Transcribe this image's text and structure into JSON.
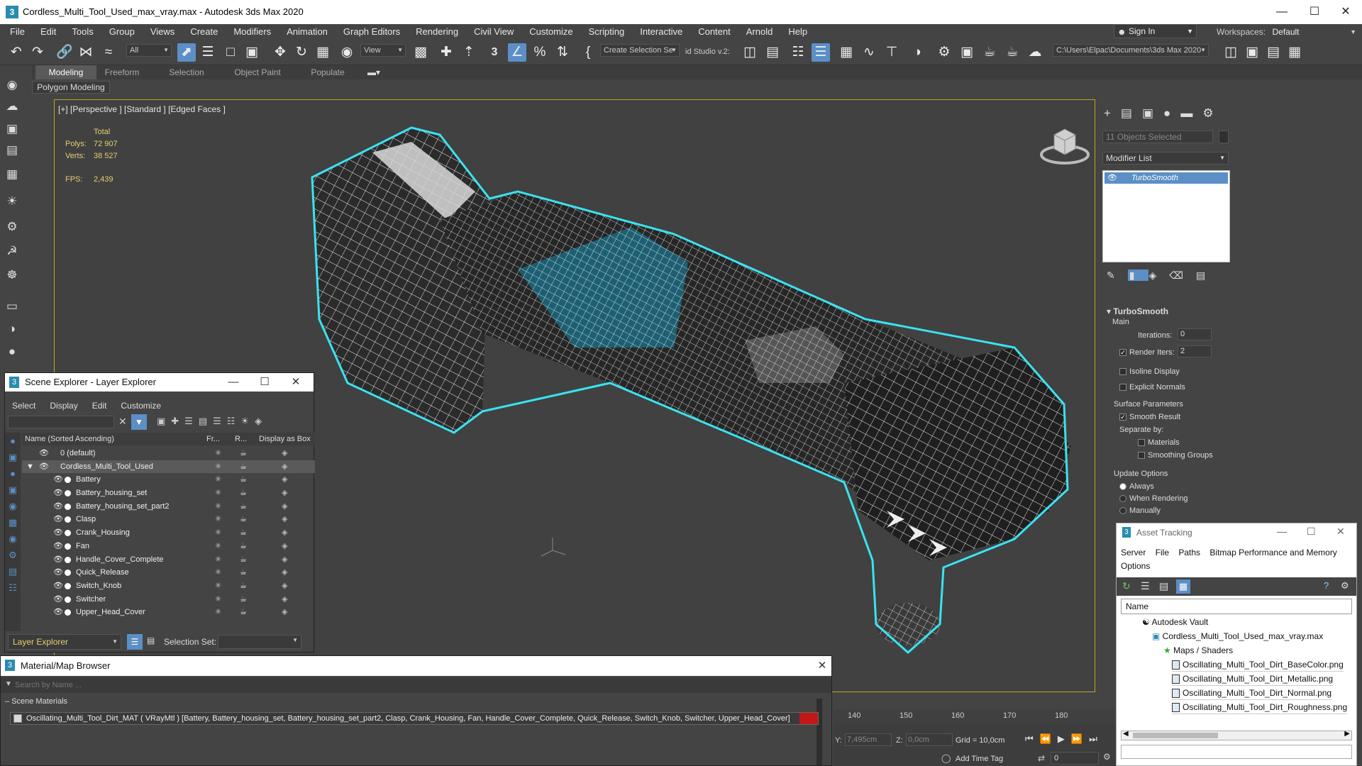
{
  "window": {
    "title": "Cordless_Multi_Tool_Used_max_vray.max - Autodesk 3ds Max 2020",
    "app_icon": "3"
  },
  "menu": [
    "File",
    "Edit",
    "Tools",
    "Group",
    "Views",
    "Create",
    "Modifiers",
    "Animation",
    "Graph Editors",
    "Rendering",
    "Civil View",
    "Customize",
    "Scripting",
    "Interactive",
    "Content",
    "Arnold",
    "Help"
  ],
  "signin": {
    "label": "Sign In"
  },
  "workspaces": {
    "label": "Workspaces:",
    "value": "Default"
  },
  "toolbar": {
    "filter": "All",
    "refcoord": "View",
    "selection_set": "Create Selection Se",
    "studio": "id Studio v.2:",
    "path": "C:\\Users\\Elpac\\Documents\\3ds Max 2020",
    "snap": "3"
  },
  "ribbon": {
    "tabs": [
      "Modeling",
      "Freeform",
      "Selection",
      "Object Paint",
      "Populate"
    ],
    "sub": "Polygon Modeling"
  },
  "viewport": {
    "label": "[+] [Perspective ] [Standard ] [Edged Faces ]",
    "stats": {
      "total": "Total",
      "polys_label": "Polys:",
      "polys": "72 907",
      "verts_label": "Verts:",
      "verts": "38 527",
      "fps_label": "FPS:",
      "fps": "2,439"
    }
  },
  "scene_explorer": {
    "title": "Scene Explorer - Layer Explorer",
    "menu": [
      "Select",
      "Display",
      "Edit",
      "Customize"
    ],
    "columns": [
      "Name (Sorted Ascending)",
      "Fr...",
      "R...",
      "Display as Box"
    ],
    "rows": [
      {
        "name": "0 (default)"
      },
      {
        "name": "Cordless_Multi_Tool_Used"
      },
      {
        "name": "Battery"
      },
      {
        "name": "Battery_housing_set"
      },
      {
        "name": "Battery_housing_set_part2"
      },
      {
        "name": "Clasp"
      },
      {
        "name": "Crank_Housing"
      },
      {
        "name": "Fan"
      },
      {
        "name": "Handle_Cover_Complete"
      },
      {
        "name": "Quick_Release"
      },
      {
        "name": "Switch_Knob"
      },
      {
        "name": "Switcher"
      },
      {
        "name": "Upper_Head_Cover"
      }
    ],
    "footer_layer": "Layer Explorer",
    "footer_selset": "Selection Set:"
  },
  "material_browser": {
    "title": "Material/Map Browser",
    "search_placeholder": "Search by Name ...",
    "section": "Scene Materials",
    "material": "Oscillating_Multi_Tool_Dirt_MAT ( VRayMtl ) [Battery, Battery_housing_set, Battery_housing_set_part2, Clasp, Crank_Housing, Fan, Handle_Cover_Complete, Quick_Release, Switch_Knob, Switcher, Upper_Head_Cover]"
  },
  "command_panel": {
    "objects_selected": "11 Objects Selected",
    "modifier_list": "Modifier List",
    "stack_item": "TurboSmooth",
    "rollout_title": "TurboSmooth",
    "main": "Main",
    "iterations_label": "Iterations:",
    "iterations": "0",
    "render_iters_label": "Render Iters:",
    "render_iters": "2",
    "isoline": "Isoline Display",
    "explicit_normals": "Explicit Normals",
    "surface_params": "Surface Parameters",
    "smooth_result": "Smooth Result",
    "separate_by": "Separate by:",
    "materials": "Materials",
    "smoothing_groups": "Smoothing Groups",
    "update_options": "Update Options",
    "always": "Always",
    "when_rendering": "When Rendering",
    "manually": "Manually"
  },
  "asset_tracking": {
    "title": "Asset Tracking",
    "menu": [
      "Server",
      "File",
      "Paths",
      "Bitmap Performance and Memory",
      "Options"
    ],
    "column": "Name",
    "items": [
      {
        "label": "Autodesk Vault",
        "level": 1
      },
      {
        "label": "Cordless_Multi_Tool_Used_max_vray.max",
        "level": 2
      },
      {
        "label": "Maps / Shaders",
        "level": 3
      },
      {
        "label": "Oscillating_Multi_Tool_Dirt_BaseColor.png",
        "level": 4
      },
      {
        "label": "Oscillating_Multi_Tool_Dirt_Metallic.png",
        "level": 4
      },
      {
        "label": "Oscillating_Multi_Tool_Dirt_Normal.png",
        "level": 4
      },
      {
        "label": "Oscillating_Multi_Tool_Dirt_Roughness.png",
        "level": 4
      }
    ]
  },
  "timeline": {
    "ticks": [
      "140",
      "150",
      "160",
      "170",
      "180"
    ],
    "y_label": "Y:",
    "y_value": "7,495cm",
    "z_label": "Z:",
    "z_value": "0,0cm",
    "grid": "Grid = 10,0cm",
    "add_time_tag": "Add Time Tag",
    "frame": "0"
  },
  "colors": {
    "accent": "#5b8fc6",
    "selection_outline": "#39e3f0",
    "viewport_border": "#c3a51c",
    "stat_text": "#e2d070"
  }
}
